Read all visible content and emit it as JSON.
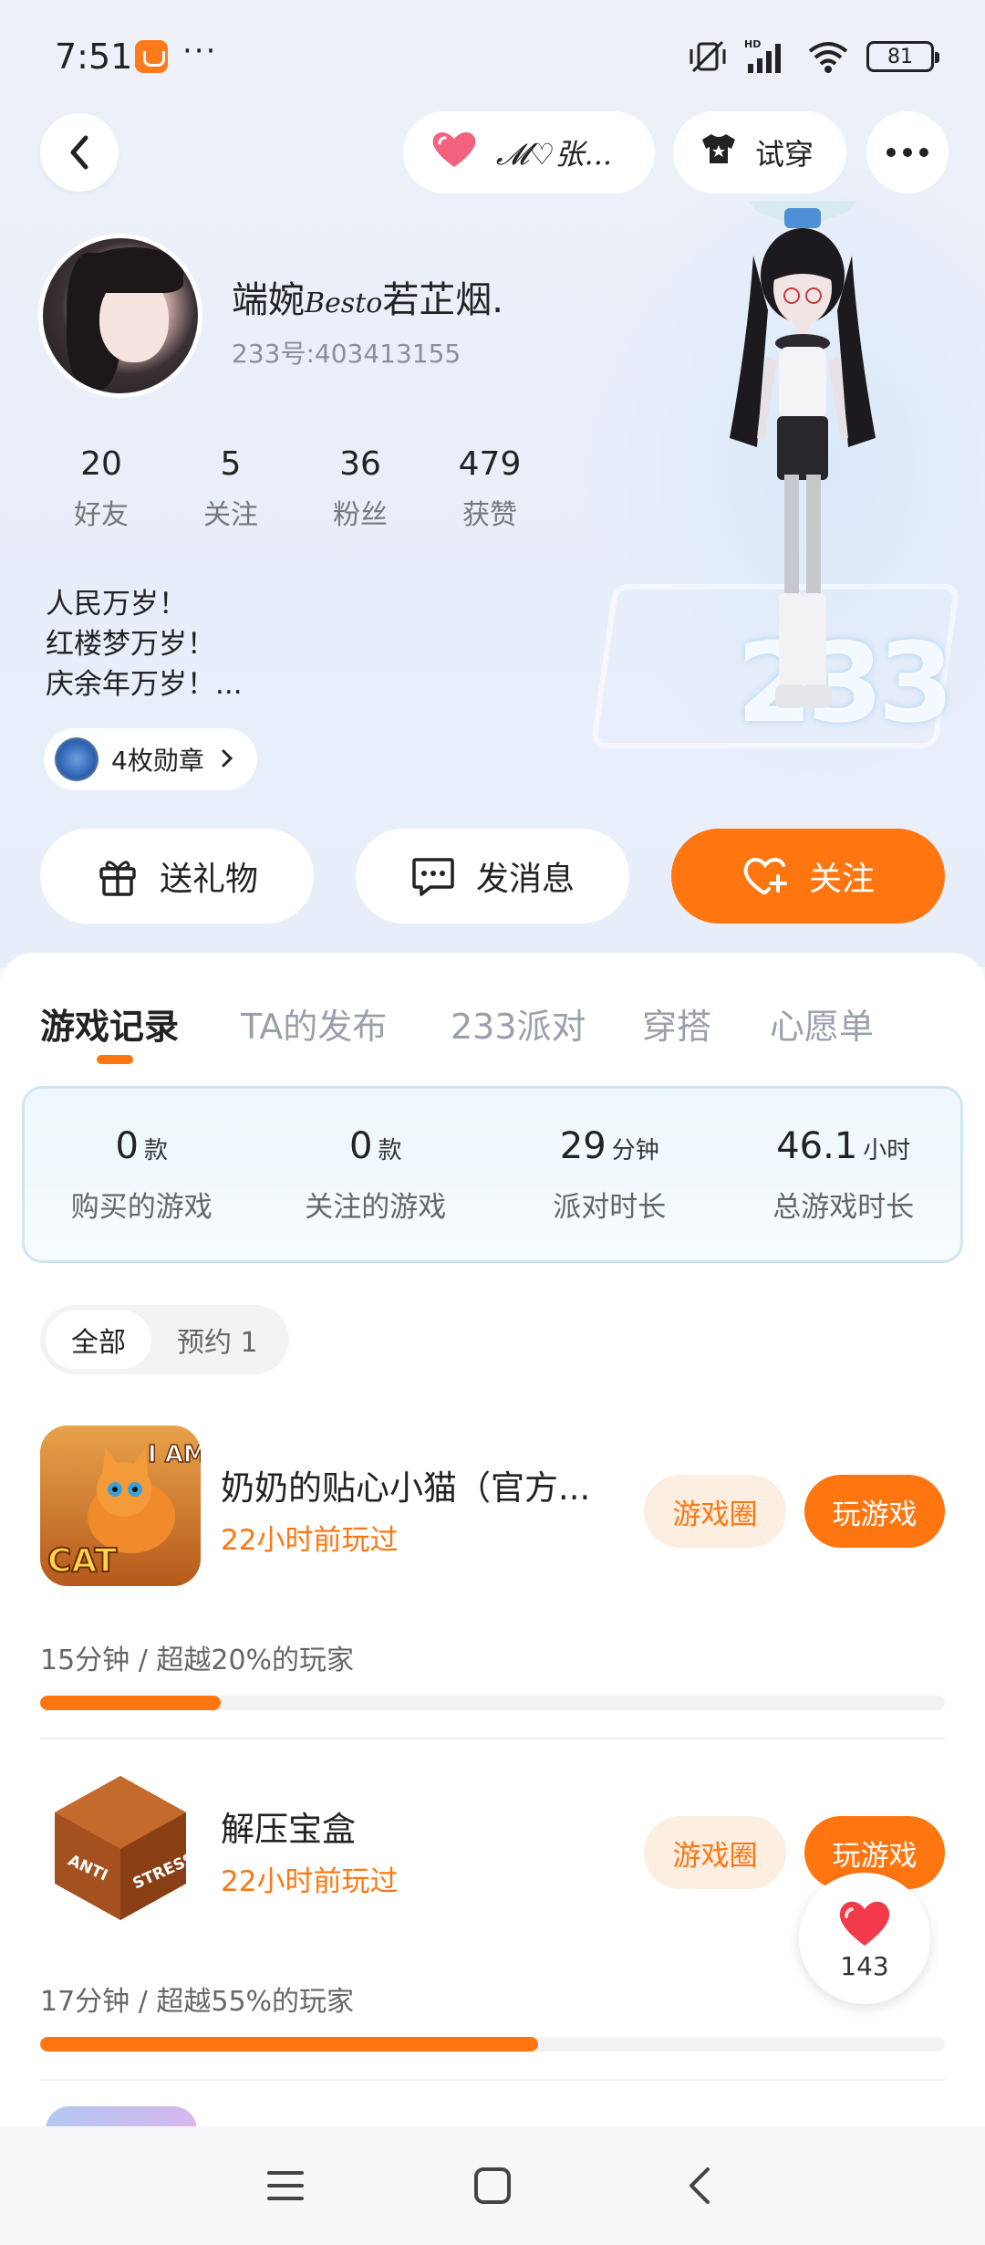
{
  "status_bar": {
    "time": "7:51",
    "more": "···",
    "battery": "81",
    "network_label": "HD"
  },
  "top_nav": {
    "friend_name": "𝓜♡张...",
    "try_on_label": "试穿"
  },
  "profile": {
    "name_prefix": "端婉",
    "name_fancy": "Besto",
    "name_suffix": "若芷烟.",
    "uid": "233号:403413155",
    "stats": [
      {
        "value": "20",
        "label": "好友"
      },
      {
        "value": "5",
        "label": "关注"
      },
      {
        "value": "36",
        "label": "粉丝"
      },
      {
        "value": "479",
        "label": "获赞"
      }
    ],
    "bio": [
      "人民万岁！",
      "红楼梦万岁！",
      "庆余年万岁！..."
    ],
    "medal_label": "4枚勋章",
    "badge_number": "233"
  },
  "actions": {
    "gift": "送礼物",
    "message": "发消息",
    "follow": "关注"
  },
  "tabs": [
    "游戏记录",
    "TA的发布",
    "233派对",
    "穿搭",
    "心愿单"
  ],
  "summary": [
    {
      "value": "0",
      "unit": "款",
      "label": "购买的游戏"
    },
    {
      "value": "0",
      "unit": "款",
      "label": "关注的游戏"
    },
    {
      "value": "29",
      "unit": "分钟",
      "label": "派对时长"
    },
    {
      "value": "46.1",
      "unit": "小时",
      "label": "总游戏时长"
    }
  ],
  "filters": [
    "全部",
    "预约 1"
  ],
  "games": [
    {
      "title": "奶奶的贴心小猫（官方...",
      "last_played": "22小时前玩过",
      "circle_label": "游戏圈",
      "play_label": "玩游戏",
      "meta": "15分钟 / 超越20%的玩家",
      "progress": 0.2,
      "icon_text_1": "I AM",
      "icon_text_2": "CAT"
    },
    {
      "title": "解压宝盒",
      "last_played": "22小时前玩过",
      "circle_label": "游戏圈",
      "play_label": "玩游戏",
      "meta": "17分钟 / 超越55%的玩家",
      "progress": 0.55,
      "icon_text_1": "ANTI",
      "icon_text_2": "STRESS"
    }
  ],
  "like_count": "143",
  "colors": {
    "accent": "#ff7611",
    "accent_soft": "#fdeee2",
    "panel_border": "#cfe6f2"
  }
}
